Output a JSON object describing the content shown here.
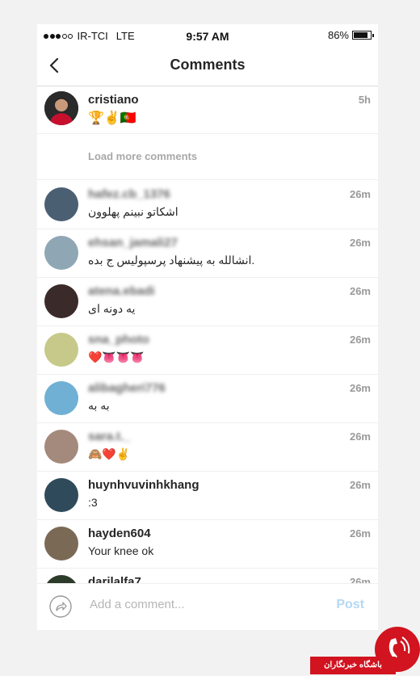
{
  "status_bar": {
    "carrier": "IR-TCI",
    "network": "LTE",
    "time": "9:57 AM",
    "battery": "86%",
    "battery_level": 0.86,
    "signal_bars_filled": 3,
    "signal_bars_total": 5
  },
  "header": {
    "title": "Comments",
    "back_icon": "chevron-left-icon"
  },
  "caption": {
    "username": "cristiano",
    "text": "🏆✌️🇵🇹",
    "time": "5h"
  },
  "load_more": "Load more comments",
  "comments": [
    {
      "username": "hafez.cb_1376",
      "text": "اشکاتو نبینم پهلوون",
      "time": "26m",
      "blurred": true,
      "avatar_color": "#4b5f73"
    },
    {
      "username": "ehsan_jamali27",
      "text": "انشالله به پیشنهاد پرسپولیس ج بده.",
      "time": "26m",
      "blurred": true,
      "avatar_color": "#8fa7b5"
    },
    {
      "username": "atena.ebadi",
      "text": "یه دونه ای",
      "time": "26m",
      "blurred": true,
      "avatar_color": "#3a2b2a"
    },
    {
      "username": "sna_photo",
      "text": "❤️👅👅👅",
      "time": "26m",
      "blurred": true,
      "avatar_color": "#c7c98a"
    },
    {
      "username": "alibagheri776",
      "text": "به به",
      "time": "26m",
      "blurred": true,
      "avatar_color": "#6fb0d4"
    },
    {
      "username": "sara.t._",
      "text": "🙈❤️✌️",
      "time": "26m",
      "blurred": true,
      "avatar_color": "#a48a7c"
    },
    {
      "username": "huynhvuvinhkhang",
      "text": ":3",
      "time": "26m",
      "blurred": false,
      "avatar_color": "#2f4a5a"
    },
    {
      "username": "hayden604",
      "text": "Your knee ok",
      "time": "26m",
      "blurred": false,
      "avatar_color": "#7a6a55"
    },
    {
      "username": "darilalfa7",
      "text": "",
      "time": "26m",
      "blurred": false,
      "avatar_color": "#2c3b2a"
    }
  ],
  "composer": {
    "placeholder": "Add a comment...",
    "post_label": "Post",
    "icon": "share-arrow-icon"
  },
  "watermark": {
    "text": "باشگاه خبرنگاران"
  },
  "colors": {
    "accent_disabled": "#b3d8f5",
    "muted_text": "#999999",
    "divider": "#efefef",
    "watermark_red": "#d1141f"
  }
}
